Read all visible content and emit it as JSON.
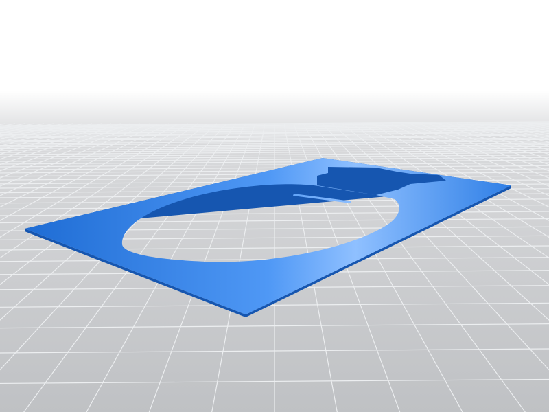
{
  "scene": {
    "subject": "stencil-plate",
    "colors": {
      "plate_dark": "#1f6fd6",
      "plate_light": "#8fc0ff",
      "floor": "#c4c6c9",
      "grid_line": "#e6e7e9",
      "sky_top": "#ffffff"
    }
  }
}
